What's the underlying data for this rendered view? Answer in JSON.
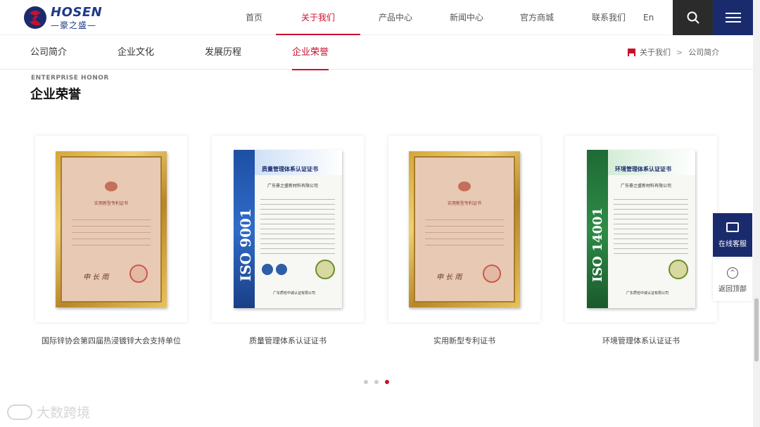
{
  "header": {
    "logo_en": "HOSEN",
    "logo_cn": "—豪之盛—",
    "nav": [
      "首页",
      "关于我们",
      "产品中心",
      "新闻中心",
      "官方商城",
      "联系我们"
    ],
    "active_nav": "关于我们",
    "lang": "En",
    "icons": {
      "search": "search-icon",
      "menu": "hamburger-menu-icon"
    }
  },
  "subnav": {
    "items": [
      "公司简介",
      "企业文化",
      "发展历程",
      "企业荣誉"
    ],
    "active": "企业荣誉",
    "breadcrumb": [
      "关于我们",
      ">",
      "公司简介"
    ]
  },
  "section": {
    "title_en": "ENTERPRISE HONOR",
    "title_cn": "企业荣誉"
  },
  "cards": [
    {
      "caption": "国际锌协会第四届热浸镀锌大会支持单位",
      "type": "framed-certificate"
    },
    {
      "caption": "质量管理体系认证证书",
      "type": "iso",
      "iso_label": "ISO 9001",
      "iso_head": "质量管理体系认证证书",
      "company": "广东豪之盛新材料有限公司"
    },
    {
      "caption": "实用新型专利证书",
      "type": "framed-certificate"
    },
    {
      "caption": "环境管理体系认证证书",
      "type": "iso",
      "iso_label": "ISO 14001",
      "iso_head": "环境管理体系认证证书",
      "company": "广东豪之盛新材料有限公司"
    }
  ],
  "frame_title": "实用新型专利证书",
  "frame_sign": "申 长 雨",
  "iso_foot": "广东质检中诚认证有限公司",
  "pagination": {
    "count": 3,
    "active_index": 2
  },
  "float": {
    "service_label": "在线客服",
    "top_label": "返回顶部"
  },
  "watermark": "大数跨境",
  "colors": {
    "accent": "#c8102e",
    "brand_navy": "#1a2b6d",
    "dark": "#2b2b2b"
  }
}
